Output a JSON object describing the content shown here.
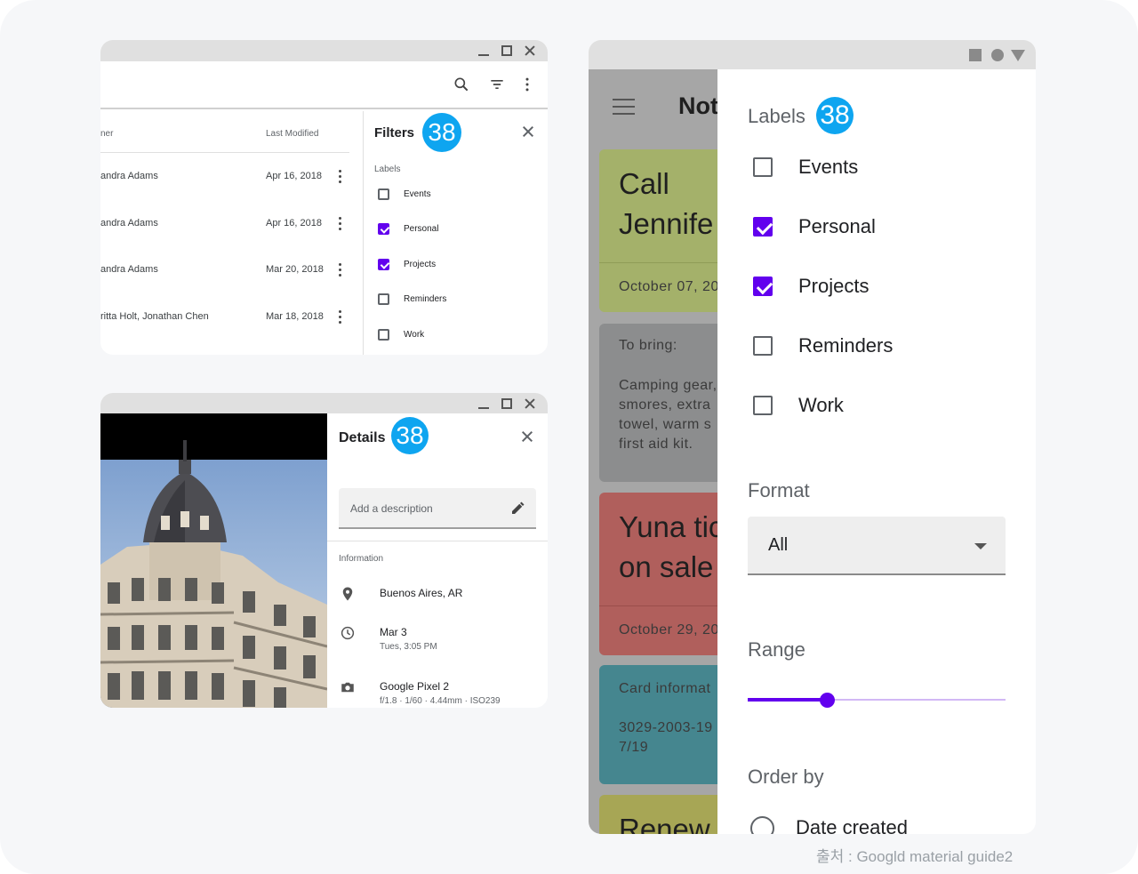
{
  "filters_window": {
    "list": {
      "owner_header": "ner",
      "modified_header": "Last Modified",
      "rows": [
        {
          "owner": "andra Adams",
          "date": "Apr 16, 2018"
        },
        {
          "owner": "andra Adams",
          "date": "Apr 16, 2018"
        },
        {
          "owner": "andra Adams",
          "date": "Mar 20, 2018"
        },
        {
          "owner": "ritta Holt, Jonathan Chen",
          "date": "Mar 18, 2018"
        }
      ]
    },
    "panel": {
      "title": "Filters",
      "badge": "38",
      "labels_heading": "Labels",
      "items": [
        {
          "label": "Events",
          "checked": false
        },
        {
          "label": "Personal",
          "checked": true
        },
        {
          "label": "Projects",
          "checked": true
        },
        {
          "label": "Reminders",
          "checked": false
        },
        {
          "label": "Work",
          "checked": false
        }
      ]
    }
  },
  "details_window": {
    "panel": {
      "title": "Details",
      "badge": "38",
      "description_placeholder": "Add a description",
      "info_heading": "Information",
      "location": "Buenos Aires, AR",
      "date": "Mar 3",
      "time": "Tues, 3:05 PM",
      "device": "Google Pixel 2",
      "camera_specs": "f/1.8 · 1/60 · 4.44mm · ISO239"
    }
  },
  "notes_window": {
    "app_title": "Not",
    "cards": [
      {
        "title": "Call\nJennife",
        "date": "October 07, 20",
        "color": "#a4b16a",
        "divider": "#8f9c57"
      },
      {
        "heading": "To bring:",
        "body": "Camping gear,\nsmores, extra\ntowel, warm s\nfirst aid kit.",
        "color": "#8c8d8e"
      },
      {
        "title": "Yuna tic\non sale",
        "date": "October 29, 20",
        "color": "#b05f5c",
        "divider": "#9a4e4b"
      },
      {
        "heading": "Card informat",
        "body": "3029-2003-19\n7/19",
        "color": "#45868f"
      },
      {
        "title": "Renew",
        "color": "#a7a655"
      }
    ],
    "sheet": {
      "labels_heading": "Labels",
      "badge": "38",
      "items": [
        {
          "label": "Events",
          "checked": false
        },
        {
          "label": "Personal",
          "checked": true
        },
        {
          "label": "Projects",
          "checked": true
        },
        {
          "label": "Reminders",
          "checked": false
        },
        {
          "label": "Work",
          "checked": false
        }
      ],
      "format_heading": "Format",
      "format_value": "All",
      "range_heading": "Range",
      "range_fraction": 0.31,
      "order_heading": "Order by",
      "order_option": "Date created"
    }
  },
  "credit": "출처 : Googld material guide2",
  "colors": {
    "accent": "#6200ee",
    "badge": "#0ea5f0",
    "titlebar": "#e0e0e0"
  }
}
